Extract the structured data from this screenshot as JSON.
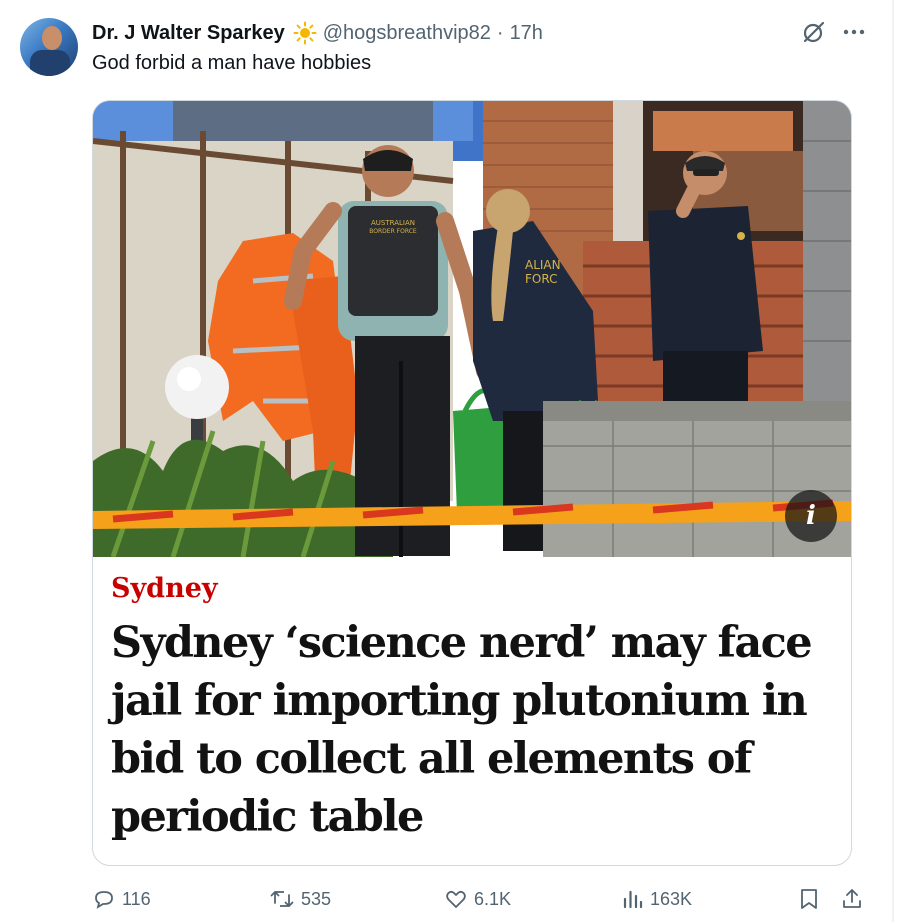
{
  "tweet": {
    "display_name": "Dr. J Walter Sparkey",
    "badge_icon": "sun-icon",
    "handle": "@hogsbreathvip82",
    "separator": "·",
    "time": "17h",
    "text": "God forbid a man have hobbies",
    "top_icons": [
      "grok-icon",
      "more-icon"
    ]
  },
  "card": {
    "image_icon": "info-icon",
    "info_label": "i",
    "kicker": "Sydney",
    "headline": "Sydney ‘science nerd’ may face jail for importing plutonium in bid to collect all elements of periodic table"
  },
  "actions": {
    "replies": "116",
    "reposts": "535",
    "likes": "6.1K",
    "views": "163K",
    "icons": [
      "reply-icon",
      "repost-icon",
      "like-icon",
      "views-icon",
      "bookmark-icon",
      "share-icon"
    ]
  },
  "colors": {
    "text_primary": "#0f1419",
    "text_secondary": "#536471",
    "kicker_red": "#c70000",
    "badge_sun": "#f5b800",
    "border": "#cfd9de"
  }
}
